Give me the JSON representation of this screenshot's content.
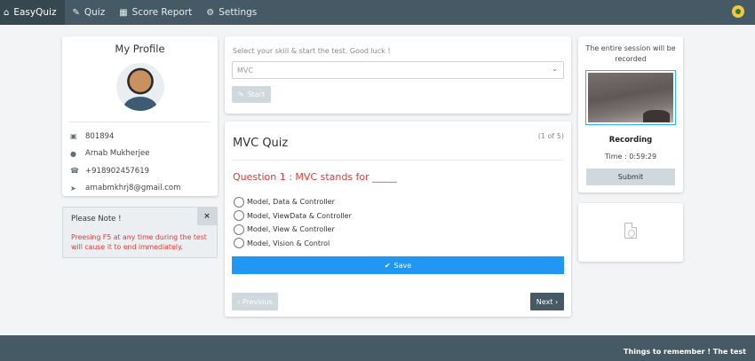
{
  "navbar": {
    "brand": "EasyQuiz",
    "items": [
      {
        "label": "Quiz",
        "icon": "edit-icon"
      },
      {
        "label": "Score Report",
        "icon": "table-icon"
      },
      {
        "label": "Settings",
        "icon": "gear-icon"
      }
    ]
  },
  "profile": {
    "title": "My Profile",
    "id": "801894",
    "name": "Arnab Mukherjee",
    "phone": "+918902457619",
    "email": "arnabmkhrj8@gmail.com"
  },
  "note": {
    "title": "Please Note !",
    "close": "×",
    "text": "Preesing F5 at any time during the test will cause it to end immediately."
  },
  "skill": {
    "hint": "Select your skill & start the test. Good luck !",
    "selected": "MVC",
    "start_label": "Start"
  },
  "quiz": {
    "title": "MVC Quiz",
    "counter": "(1 of 5)",
    "question": "Question 1 : MVC stands for _____",
    "options": [
      "Model, Data & Controller",
      "Model, ViewData & Controller",
      "Model, View & Controller",
      "Model, Vision & Control"
    ],
    "save_label": "Save",
    "prev_label": "‹ Previous",
    "next_label": "Next ›"
  },
  "recording": {
    "note": "The entire session will be recorded",
    "status": "Recording",
    "time": "Time : 0:59:29",
    "submit_label": "Submit"
  },
  "footer": {
    "text": "Things to remember ! The test"
  },
  "colors": {
    "navbar": "#455a64",
    "accent_blue": "#2196f3",
    "question_red": "#e53935",
    "disabled_button": "#cfd8dc"
  }
}
